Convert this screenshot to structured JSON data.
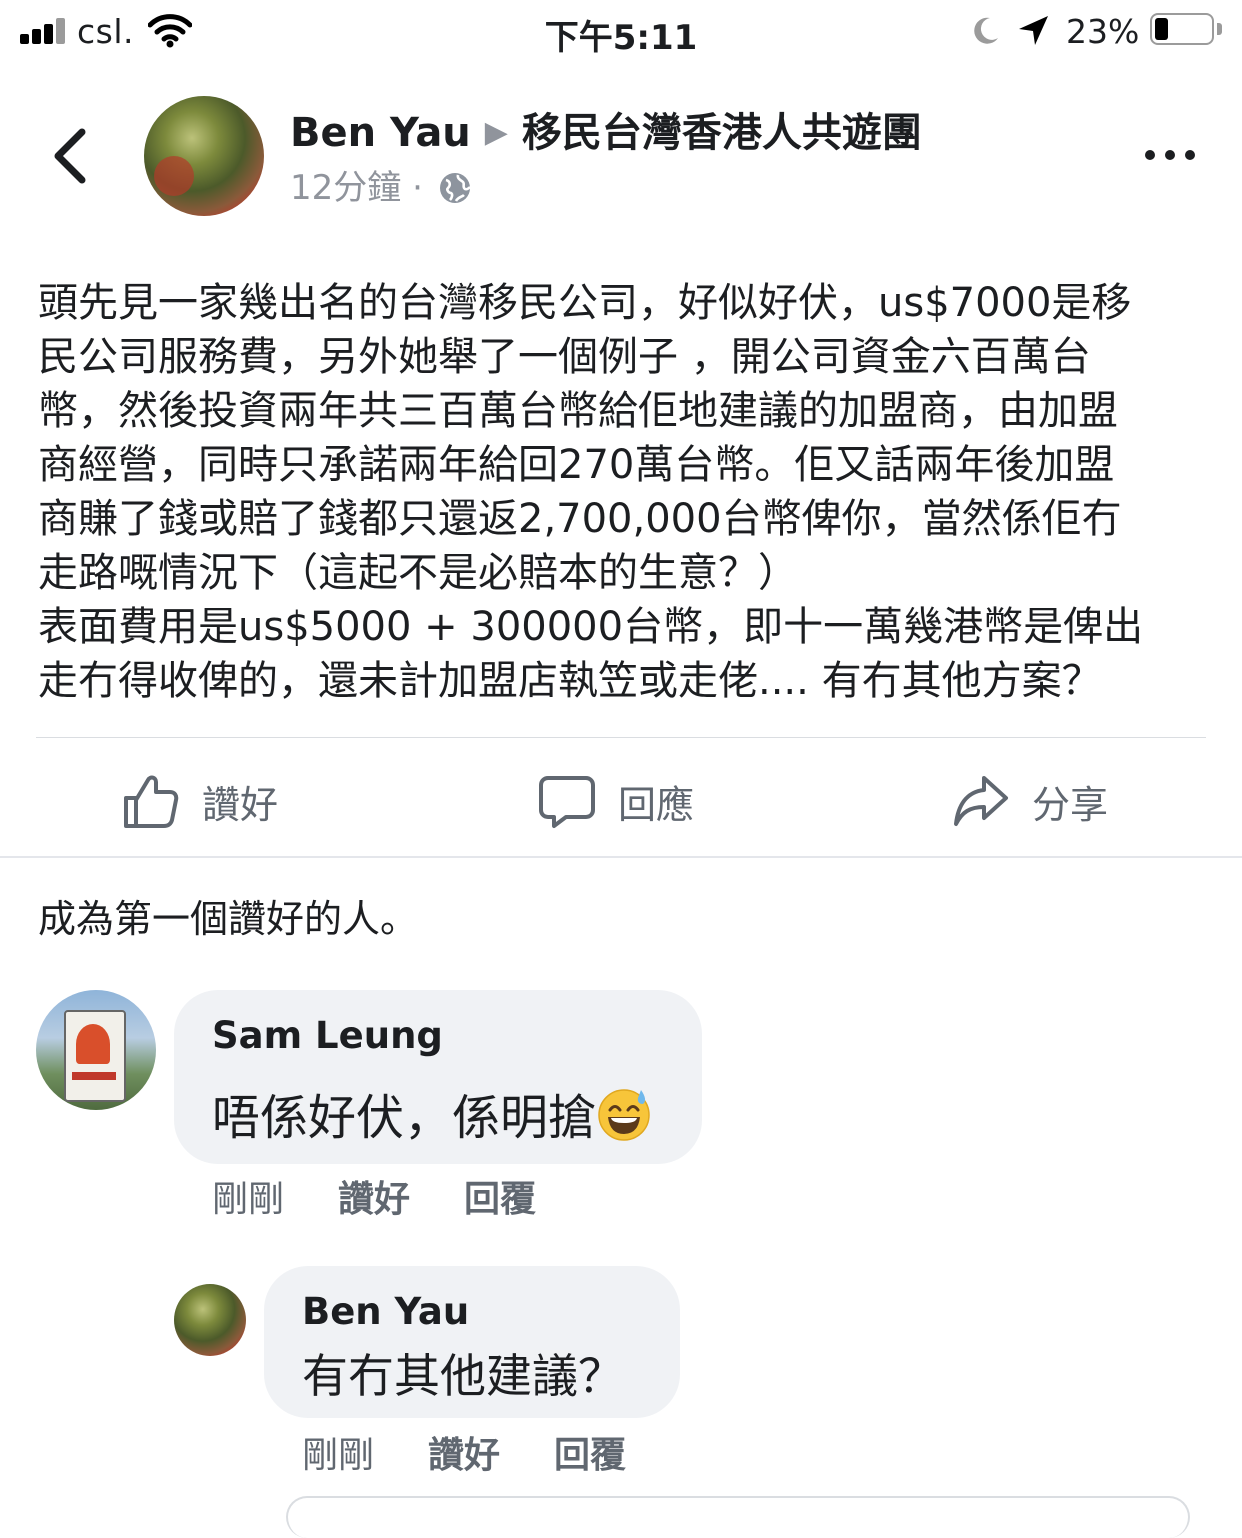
{
  "status_bar": {
    "carrier": "csl.",
    "time": "下午5:11",
    "battery_percent": "23%",
    "battery_level": 0.23
  },
  "header": {
    "author": "Ben Yau",
    "group": "移民台灣香港人共遊團",
    "time_ago": "12分鐘",
    "separator": "·"
  },
  "post": {
    "text": "頭先見一家幾出名的台灣移民公司，好似好伏，us$7000是移\n民公司服務費，另外她舉了一個例子 ，開公司資金六百萬台\n幣，然後投資兩年共三百萬台幣給佢地建議的加盟商，由加盟\n商經營，同時只承諾兩年給回270萬台幣。佢又話兩年後加盟\n商賺了錢或賠了錢都只還返2,700,000台幣俾你，當然係佢冇\n走路嘅情況下（這起不是必賠本的生意？）\n表面費用是us$5000 + 300000台幣，即十一萬幾港幣是俾出\n走冇得收俾的，還未計加盟店執笠或走佬.... 有冇其他方案？"
  },
  "actions": {
    "like": "讚好",
    "comment": "回應",
    "share": "分享"
  },
  "likes_summary": "成為第一個讚好的人。",
  "comments": [
    {
      "author": "Sam Leung",
      "text": "唔係好伏，係明搶",
      "emoji": "grinning-sweat-emoji",
      "time": "剛剛",
      "like_label": "讚好",
      "reply_label": "回覆"
    },
    {
      "author": "Ben Yau",
      "text": "有冇其他建議？",
      "time": "剛剛",
      "like_label": "讚好",
      "reply_label": "回覆"
    }
  ],
  "colors": {
    "text": "#1c1e21",
    "secondary": "#606770",
    "bubble": "#f0f2f5",
    "divider": "#dadde1"
  }
}
